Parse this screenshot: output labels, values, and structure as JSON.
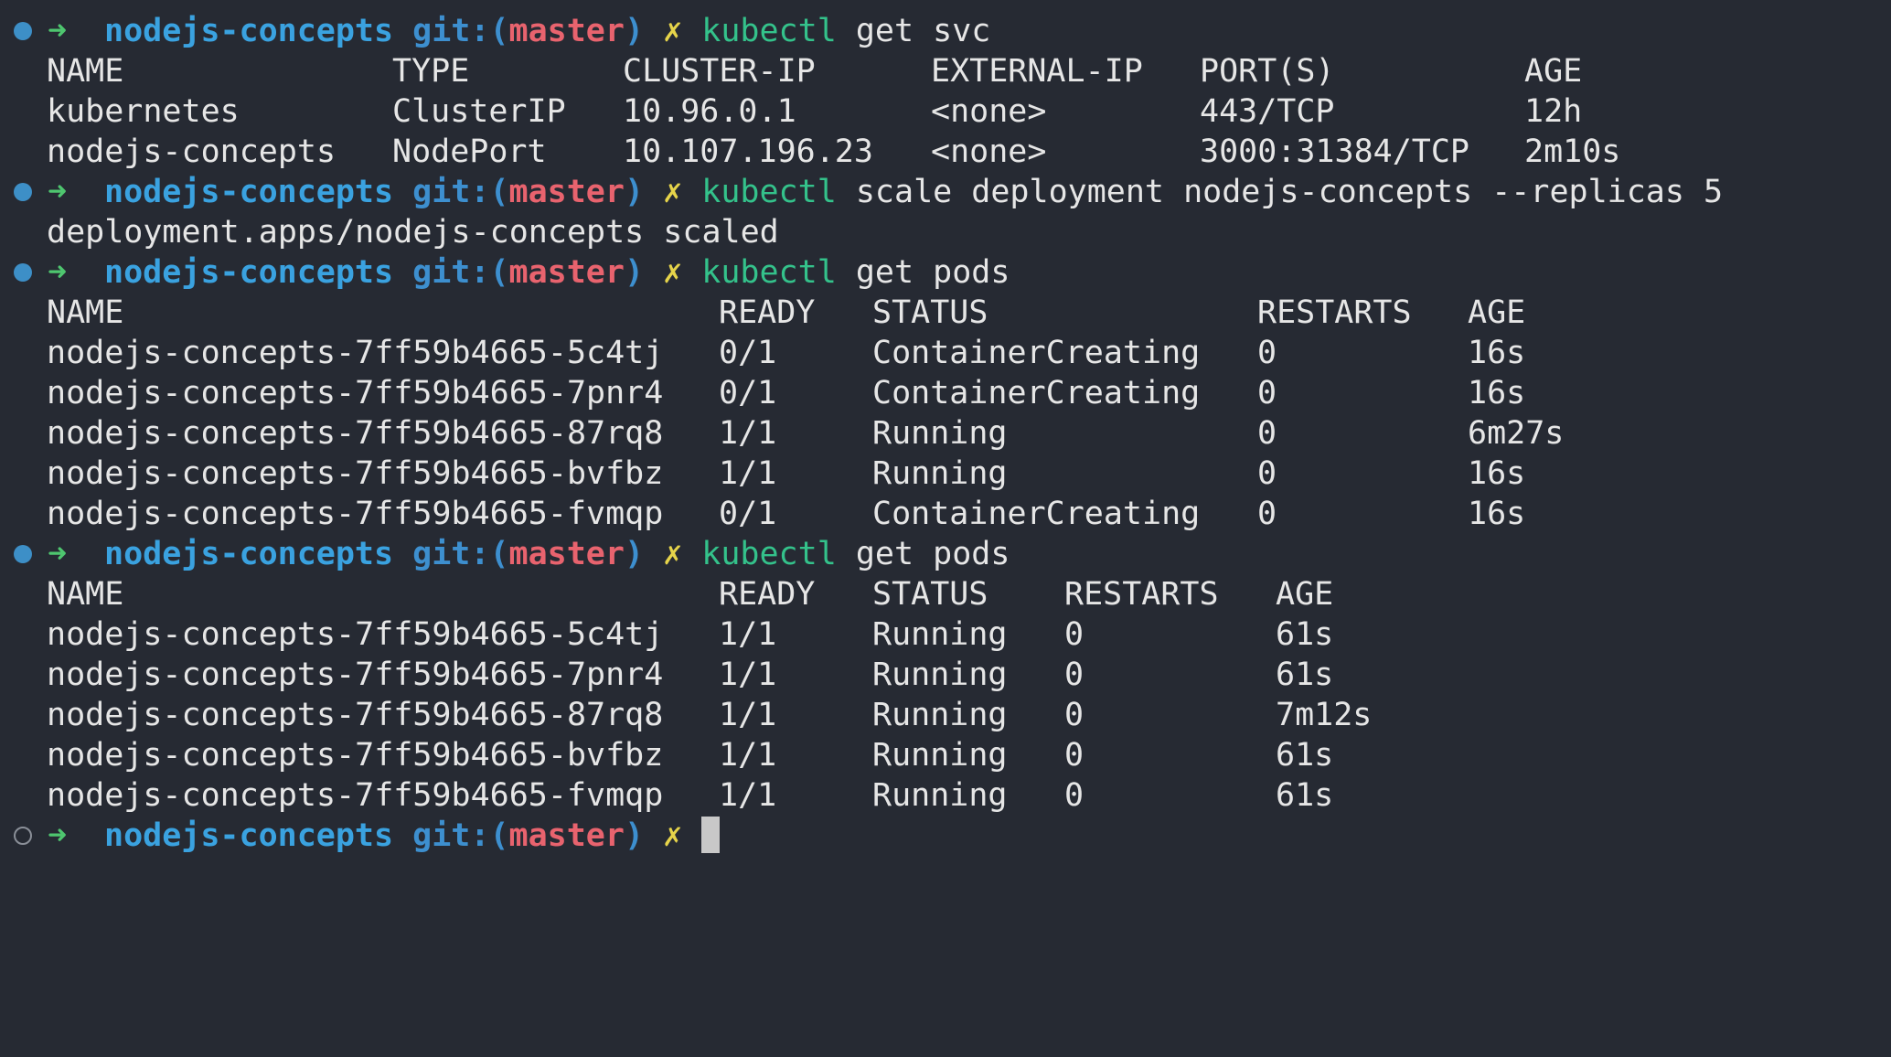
{
  "prompt": {
    "dir": "nodejs-concepts",
    "git_label": "git:(",
    "branch": "master",
    "git_close": ")",
    "dirty": "✗",
    "arrow": "➜"
  },
  "block1": {
    "command": "kubectl",
    "args": "get svc",
    "headers": [
      "NAME",
      "TYPE",
      "CLUSTER-IP",
      "EXTERNAL-IP",
      "PORT(S)",
      "AGE"
    ],
    "rows": [
      [
        "kubernetes",
        "ClusterIP",
        "10.96.0.1",
        "<none>",
        "443/TCP",
        "12h"
      ],
      [
        "nodejs-concepts",
        "NodePort",
        "10.107.196.23",
        "<none>",
        "3000:31384/TCP",
        "2m10s"
      ]
    ]
  },
  "block2": {
    "command": "kubectl",
    "args": "scale deployment nodejs-concepts --replicas 5",
    "output": "deployment.apps/nodejs-concepts scaled"
  },
  "block3": {
    "command": "kubectl",
    "args": "get pods",
    "headers": [
      "NAME",
      "READY",
      "STATUS",
      "RESTARTS",
      "AGE"
    ],
    "rows": [
      [
        "nodejs-concepts-7ff59b4665-5c4tj",
        "0/1",
        "ContainerCreating",
        "0",
        "16s"
      ],
      [
        "nodejs-concepts-7ff59b4665-7pnr4",
        "0/1",
        "ContainerCreating",
        "0",
        "16s"
      ],
      [
        "nodejs-concepts-7ff59b4665-87rq8",
        "1/1",
        "Running",
        "0",
        "6m27s"
      ],
      [
        "nodejs-concepts-7ff59b4665-bvfbz",
        "1/1",
        "Running",
        "0",
        "16s"
      ],
      [
        "nodejs-concepts-7ff59b4665-fvmqp",
        "0/1",
        "ContainerCreating",
        "0",
        "16s"
      ]
    ]
  },
  "block4": {
    "command": "kubectl",
    "args": "get pods",
    "headers": [
      "NAME",
      "READY",
      "STATUS",
      "RESTARTS",
      "AGE"
    ],
    "rows": [
      [
        "nodejs-concepts-7ff59b4665-5c4tj",
        "1/1",
        "Running",
        "0",
        "61s"
      ],
      [
        "nodejs-concepts-7ff59b4665-7pnr4",
        "1/1",
        "Running",
        "0",
        "61s"
      ],
      [
        "nodejs-concepts-7ff59b4665-87rq8",
        "1/1",
        "Running",
        "0",
        "7m12s"
      ],
      [
        "nodejs-concepts-7ff59b4665-bvfbz",
        "1/1",
        "Running",
        "0",
        "61s"
      ],
      [
        "nodejs-concepts-7ff59b4665-fvmqp",
        "1/1",
        "Running",
        "0",
        "61s"
      ]
    ]
  }
}
